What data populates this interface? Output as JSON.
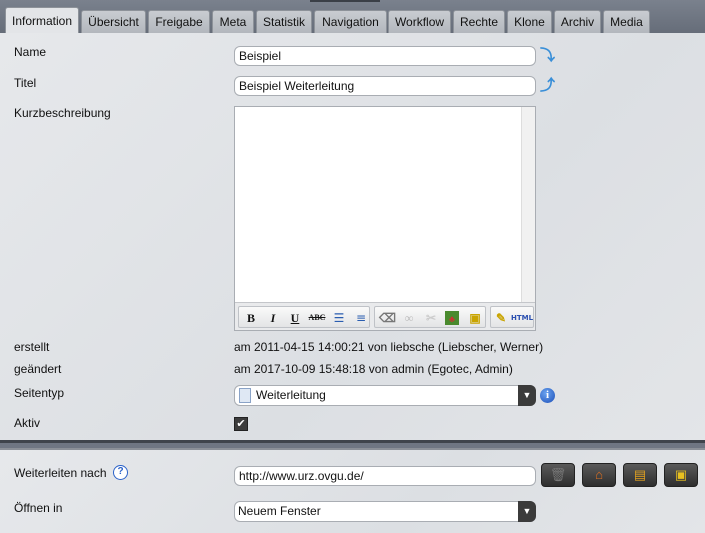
{
  "tabs": [
    {
      "label": "Information",
      "active": true
    },
    {
      "label": "Übersicht"
    },
    {
      "label": "Freigabe"
    },
    {
      "label": "Meta"
    },
    {
      "label": "Statistik"
    },
    {
      "label": "Navigation"
    },
    {
      "label": "Workflow"
    },
    {
      "label": "Rechte"
    },
    {
      "label": "Klone"
    },
    {
      "label": "Archiv"
    },
    {
      "label": "Media"
    }
  ],
  "form": {
    "name_label": "Name",
    "name_value": "Beispiel",
    "title_label": "Titel",
    "title_value": "Beispiel Weiterleitung",
    "desc_label": "Kurzbeschreibung",
    "created_label": "erstellt",
    "created_value": "am 2011-04-15 14:00:21 von liebsche (Liebscher, Werner)",
    "changed_label": "geändert",
    "changed_value": "am 2017-10-09 15:48:18 von admin (Egotec, Admin)",
    "pagetype_label": "Seitentyp",
    "pagetype_value": "Weiterleitung",
    "active_label": "Aktiv",
    "active_checked": true
  },
  "editor_toolbar": {
    "bold": "B",
    "italic": "I",
    "underline": "U",
    "strike": "ABC",
    "html": "HTML"
  },
  "redirect": {
    "label": "Weiterleiten nach",
    "url": "http://www.urz.ovgu.de/",
    "open_label": "Öffnen in",
    "open_value": "Neuem Fenster"
  },
  "icons": {
    "help": "?",
    "info": "i"
  }
}
